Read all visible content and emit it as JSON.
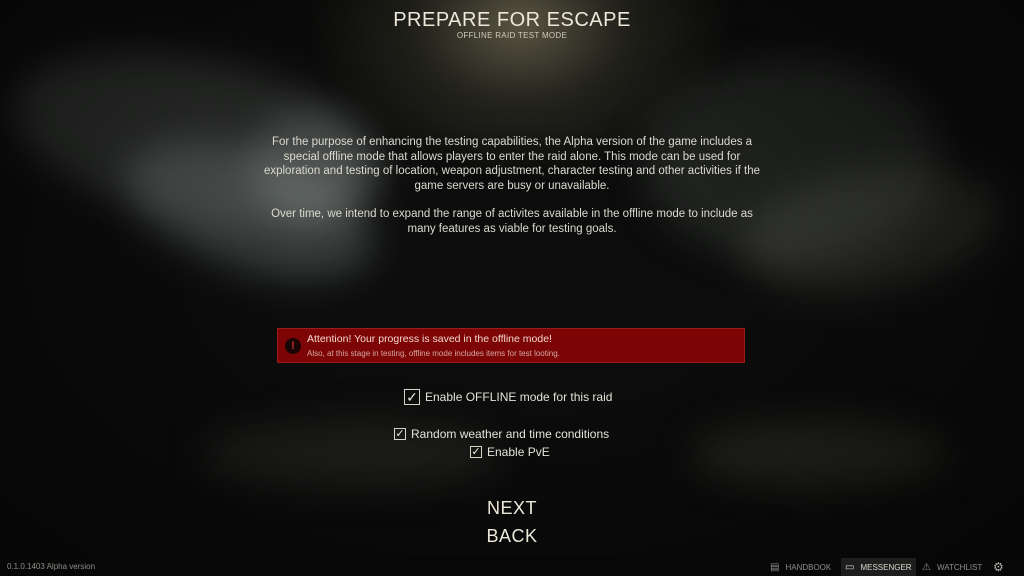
{
  "header": {
    "title": "PREPARE FOR ESCAPE",
    "subtitle": "OFFLINE RAID TEST MODE"
  },
  "description": {
    "paragraph1": "For the purpose of enhancing the testing capabilities, the Alpha version of the game includes a special offline mode that allows players to enter the raid alone. This mode can be used for exploration and testing of location, weapon adjustment, character testing and other activities if the game servers are busy or unavailable.",
    "paragraph2": "Over time, we intend to expand the range of activites available in the offline mode to include as many features as viable for testing goals."
  },
  "alert": {
    "icon": "exclamation-icon",
    "title": "Attention! Your progress is saved in the offline mode!",
    "text": "Also, at this stage in testing, offline mode includes items for test looting.",
    "color": "#7d0505"
  },
  "options": {
    "offline": {
      "label": "Enable OFFLINE mode for this raid",
      "checked": true
    },
    "weather": {
      "label": "Random weather and time conditions",
      "checked": true
    },
    "pve": {
      "label": "Enable PvE",
      "checked": true
    }
  },
  "buttons": {
    "next": "NEXT",
    "back": "BACK"
  },
  "footer": {
    "version": "0.1.0.1403 Alpha version",
    "handbook": "HANDBOOK",
    "messenger": "MESSENGER",
    "watchlist": "WATCHLIST"
  }
}
